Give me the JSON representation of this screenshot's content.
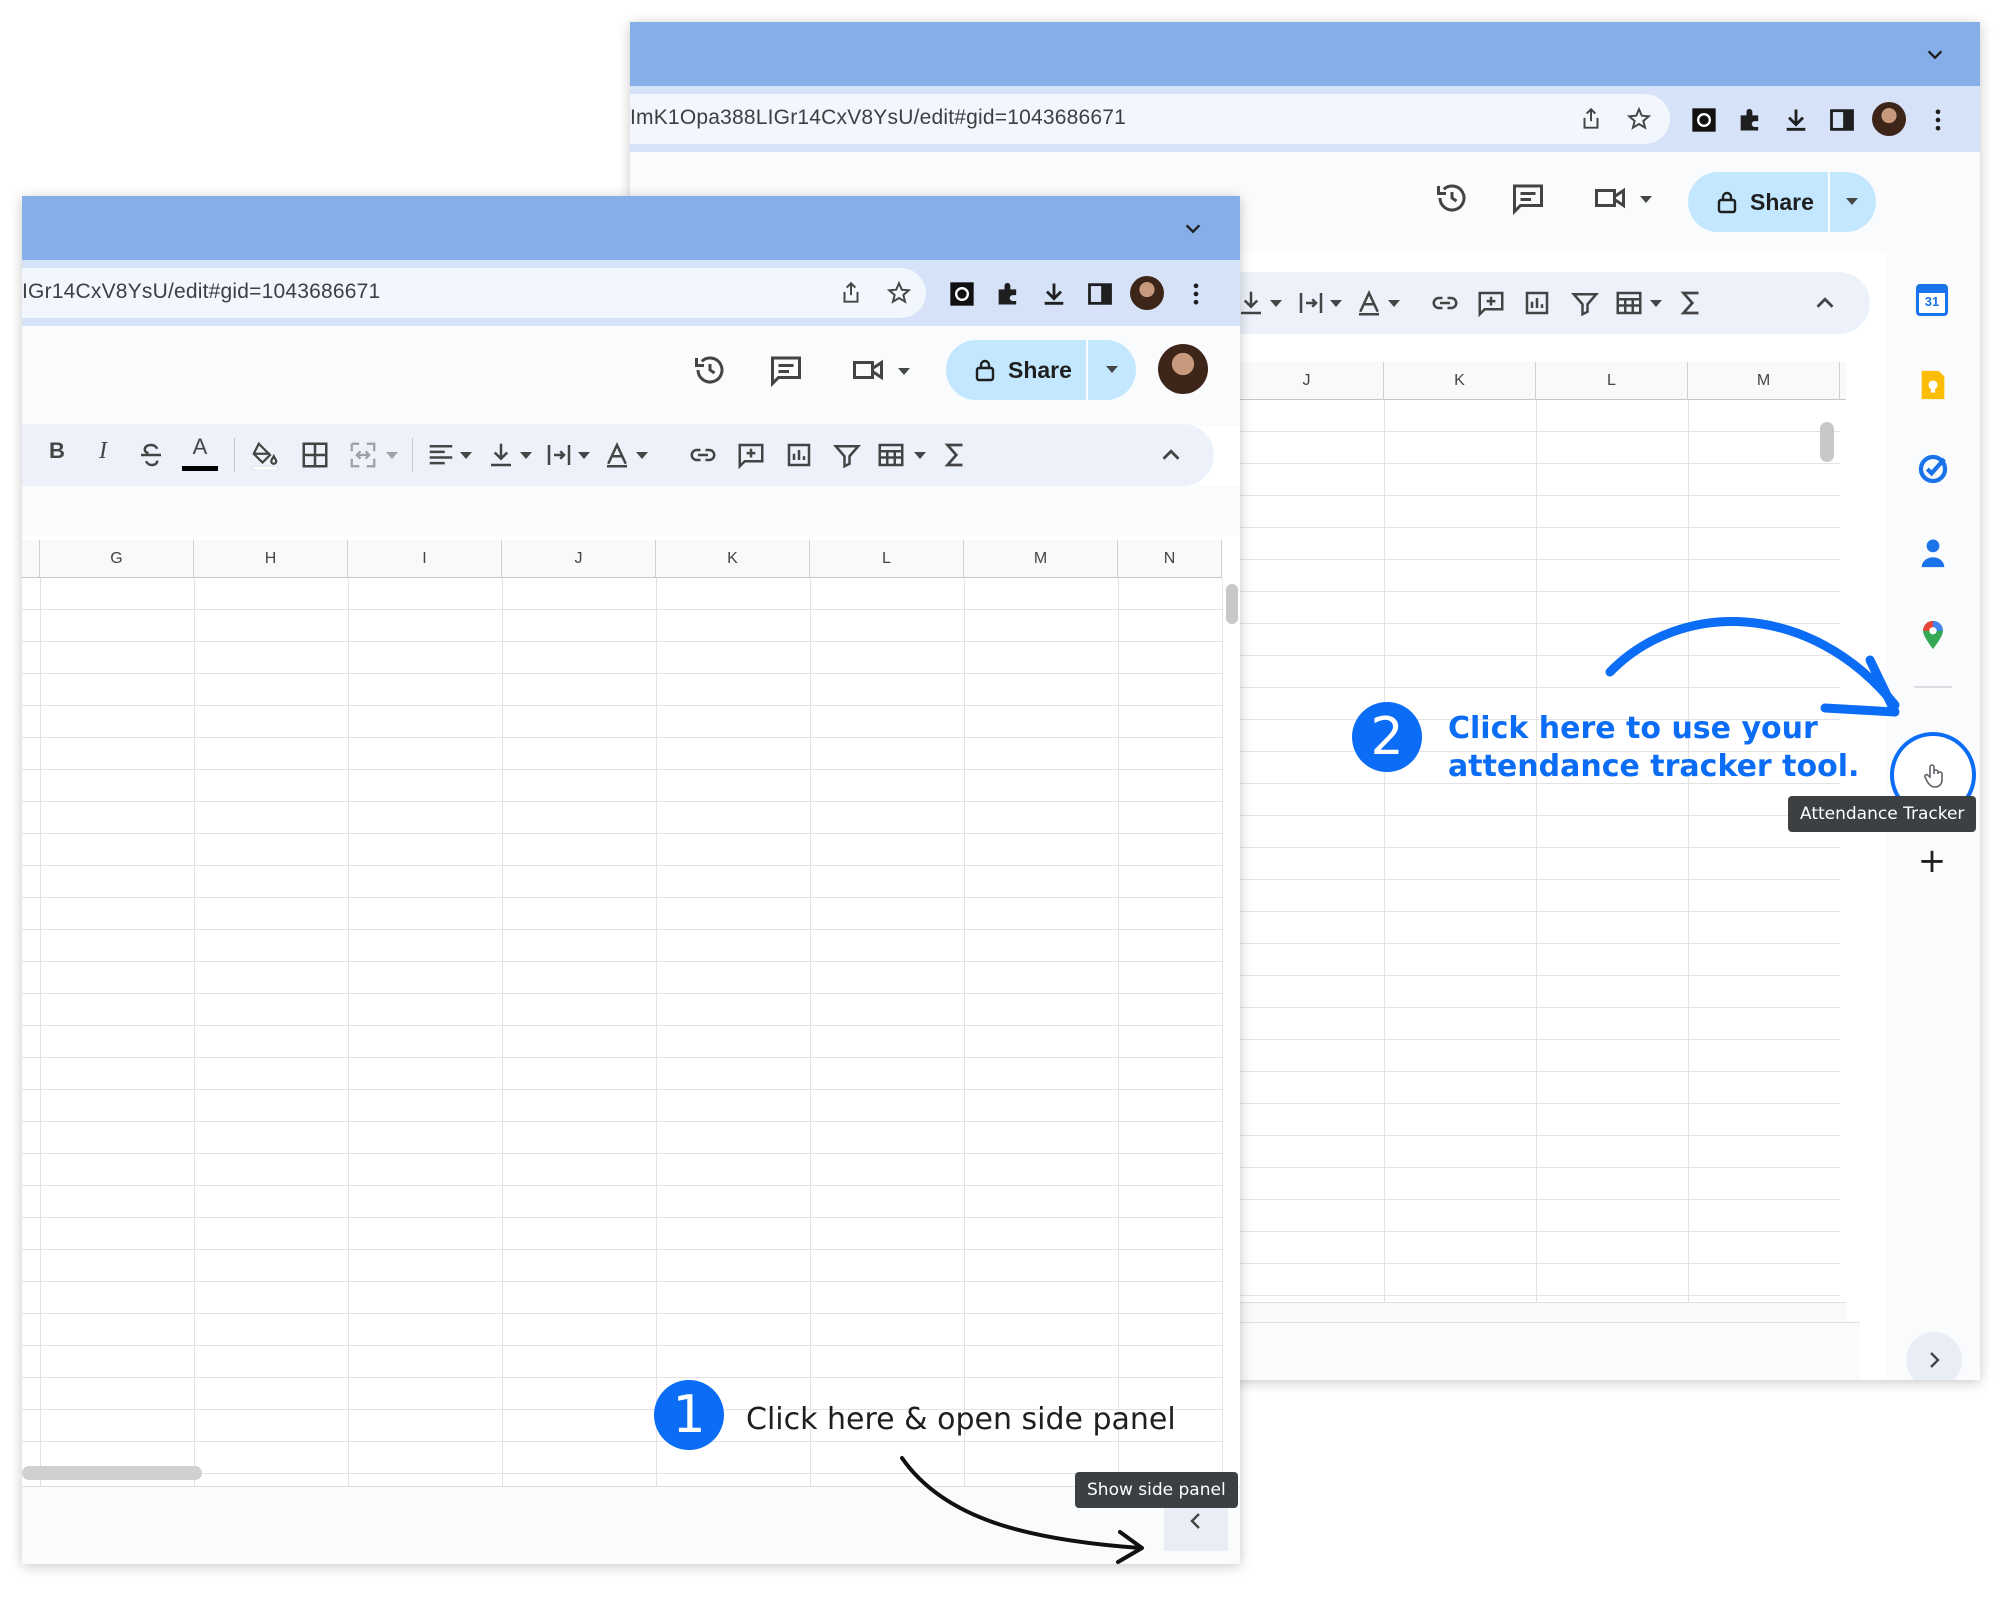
{
  "back_window": {
    "url": "ImK1Opa388LIGr14CxV8YsU/edit#gid=1043686671",
    "share_label": "Share",
    "columns": [
      "J",
      "K",
      "L",
      "M"
    ],
    "side_panel": {
      "icons": [
        "calendar-icon",
        "keep-icon",
        "tasks-icon",
        "contacts-icon",
        "maps-icon",
        "attendance-tracker-icon",
        "add-icon"
      ],
      "calendar_day": "31",
      "add_symbol": "+"
    },
    "tooltip": "Attendance Tracker"
  },
  "front_window": {
    "url": "IGr14CxV8YsU/edit#gid=1043686671",
    "share_label": "Share",
    "columns": [
      "G",
      "H",
      "I",
      "J",
      "K",
      "L",
      "M",
      "N"
    ],
    "toolbar": {
      "bold": "B",
      "italic": "I",
      "text_color_letter": "A"
    },
    "tooltip": "Show side panel"
  },
  "callouts": {
    "step1": {
      "number": "1",
      "text": "Click here & open side panel"
    },
    "step2": {
      "number": "2",
      "line1": "Click here to use your",
      "line2": "attendance tracker tool."
    }
  },
  "colors": {
    "titlebar": "#86aee9",
    "omnibar": "#d5e2f8",
    "share_button": "#c2e7ff",
    "callout_blue": "#0b6cf5",
    "toolbar_bg": "#edf2fa"
  }
}
